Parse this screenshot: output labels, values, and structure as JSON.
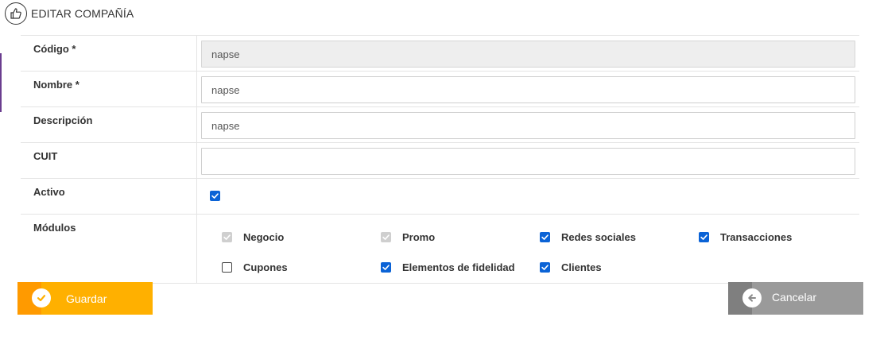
{
  "header": {
    "title": "EDITAR COMPAÑÍA",
    "icon": "thumbs-up-icon"
  },
  "fields": {
    "codigo": {
      "label": "Código *",
      "value": "napse",
      "disabled": true
    },
    "nombre": {
      "label": "Nombre *",
      "value": "napse"
    },
    "descripcion": {
      "label": "Descripción",
      "value": "napse"
    },
    "cuit": {
      "label": "CUIT",
      "value": ""
    },
    "activo": {
      "label": "Activo",
      "checked": true
    }
  },
  "modulos": {
    "label": "Módulos",
    "items": [
      {
        "label": "Negocio",
        "state": "checked-disabled"
      },
      {
        "label": "Promo",
        "state": "checked-disabled"
      },
      {
        "label": "Redes sociales",
        "state": "checked"
      },
      {
        "label": "Transacciones",
        "state": "checked"
      },
      {
        "label": "Cupones",
        "state": "unchecked"
      },
      {
        "label": "Elementos de fidelidad",
        "state": "checked"
      },
      {
        "label": "Clientes",
        "state": "checked"
      }
    ]
  },
  "buttons": {
    "save": {
      "label": "Guardar",
      "icon": "check-icon",
      "color": "#ffb000",
      "side_color": "#ff9a00"
    },
    "cancel": {
      "label": "Cancelar",
      "icon": "arrow-left-icon",
      "color": "#9a9a9a",
      "side_color": "#7f7f7f"
    }
  },
  "colors": {
    "accent": "#0b63d6",
    "left_bar": "#6a3d8f"
  }
}
